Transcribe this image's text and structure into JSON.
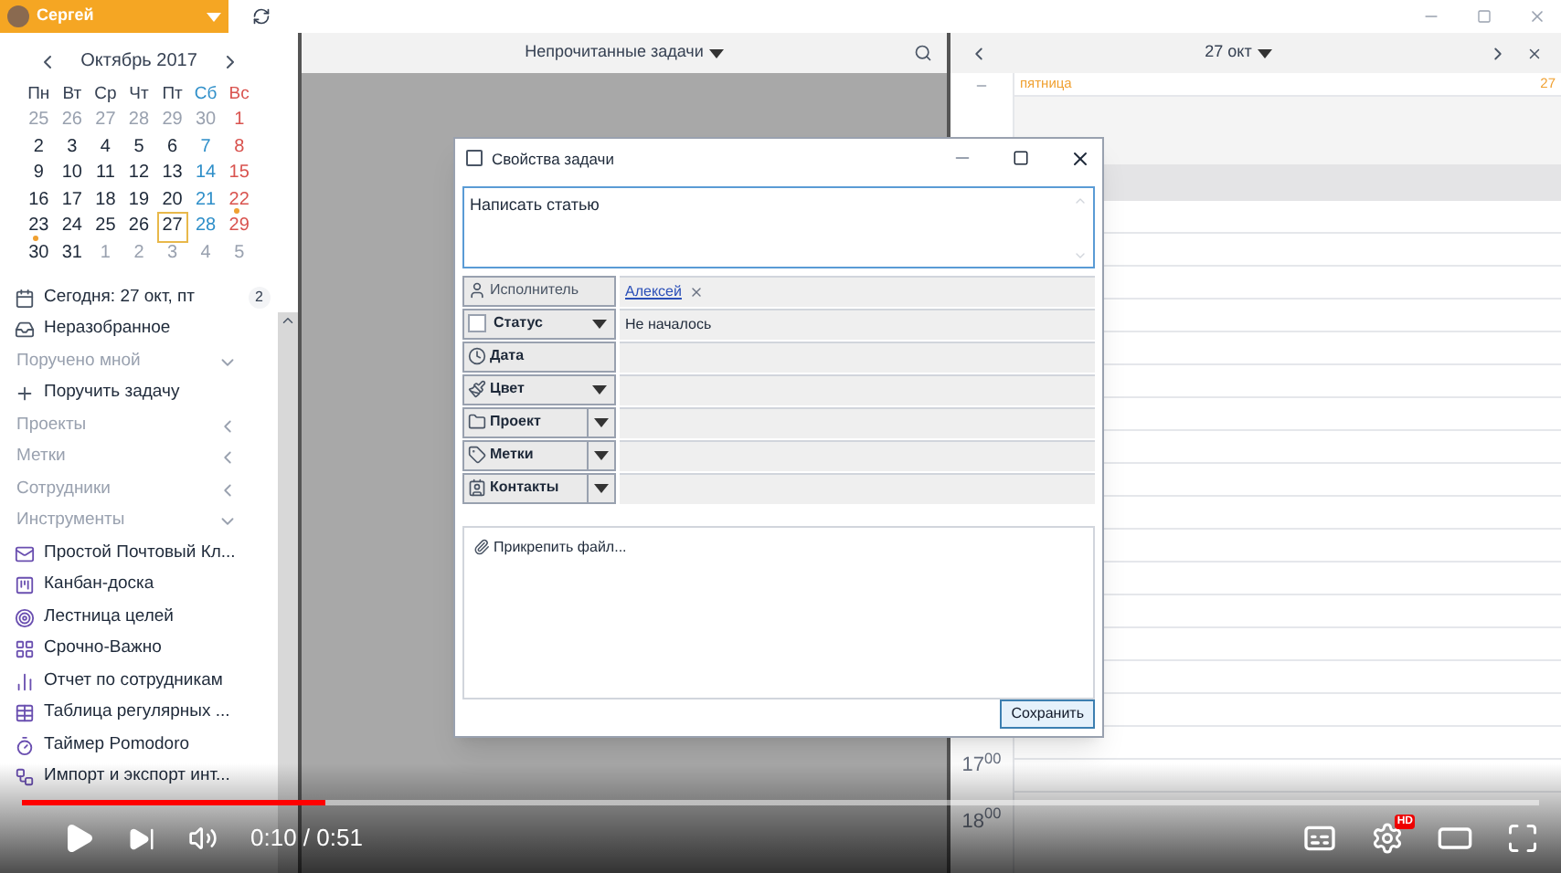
{
  "user": {
    "name": "Сергей"
  },
  "calendar": {
    "month": "Октябрь 2017",
    "weekdays": [
      "Пн",
      "Вт",
      "Ср",
      "Чт",
      "Пт",
      "Сб",
      "Вс"
    ],
    "weeks": [
      [
        {
          "d": "25",
          "muted": true,
          "today": false,
          "dot": false
        },
        {
          "d": "26",
          "muted": true,
          "today": false,
          "dot": false
        },
        {
          "d": "27",
          "muted": true,
          "today": false,
          "dot": false
        },
        {
          "d": "28",
          "muted": true,
          "today": false,
          "dot": false
        },
        {
          "d": "29",
          "muted": true,
          "today": false,
          "dot": false
        },
        {
          "d": "30",
          "muted": true,
          "today": false,
          "dot": false
        },
        {
          "d": "1",
          "muted": false,
          "today": false,
          "dot": false
        }
      ],
      [
        {
          "d": "2",
          "muted": false,
          "today": false,
          "dot": false
        },
        {
          "d": "3",
          "muted": false,
          "today": false,
          "dot": false
        },
        {
          "d": "4",
          "muted": false,
          "today": false,
          "dot": false
        },
        {
          "d": "5",
          "muted": false,
          "today": false,
          "dot": false
        },
        {
          "d": "6",
          "muted": false,
          "today": false,
          "dot": false
        },
        {
          "d": "7",
          "muted": false,
          "today": false,
          "dot": false
        },
        {
          "d": "8",
          "muted": false,
          "today": false,
          "dot": false
        }
      ],
      [
        {
          "d": "9",
          "muted": false,
          "today": false,
          "dot": false
        },
        {
          "d": "10",
          "muted": false,
          "today": false,
          "dot": false
        },
        {
          "d": "11",
          "muted": false,
          "today": false,
          "dot": false
        },
        {
          "d": "12",
          "muted": false,
          "today": false,
          "dot": false
        },
        {
          "d": "13",
          "muted": false,
          "today": false,
          "dot": false
        },
        {
          "d": "14",
          "muted": false,
          "today": false,
          "dot": false
        },
        {
          "d": "15",
          "muted": false,
          "today": false,
          "dot": false
        }
      ],
      [
        {
          "d": "16",
          "muted": false,
          "today": false,
          "dot": false
        },
        {
          "d": "17",
          "muted": false,
          "today": false,
          "dot": false
        },
        {
          "d": "18",
          "muted": false,
          "today": false,
          "dot": false
        },
        {
          "d": "19",
          "muted": false,
          "today": false,
          "dot": false
        },
        {
          "d": "20",
          "muted": false,
          "today": false,
          "dot": false
        },
        {
          "d": "21",
          "muted": false,
          "today": false,
          "dot": false
        },
        {
          "d": "22",
          "muted": false,
          "today": false,
          "dot": true
        }
      ],
      [
        {
          "d": "23",
          "muted": false,
          "today": false,
          "dot": true
        },
        {
          "d": "24",
          "muted": false,
          "today": false,
          "dot": false
        },
        {
          "d": "25",
          "muted": false,
          "today": false,
          "dot": false
        },
        {
          "d": "26",
          "muted": false,
          "today": false,
          "dot": false
        },
        {
          "d": "27",
          "muted": false,
          "today": true,
          "dot": false
        },
        {
          "d": "28",
          "muted": false,
          "today": false,
          "dot": false
        },
        {
          "d": "29",
          "muted": false,
          "today": false,
          "dot": false
        }
      ],
      [
        {
          "d": "30",
          "muted": false,
          "today": false,
          "dot": false
        },
        {
          "d": "31",
          "muted": false,
          "today": false,
          "dot": false
        },
        {
          "d": "1",
          "muted": true,
          "today": false,
          "dot": false
        },
        {
          "d": "2",
          "muted": true,
          "today": false,
          "dot": false
        },
        {
          "d": "3",
          "muted": true,
          "today": false,
          "dot": false
        },
        {
          "d": "4",
          "muted": true,
          "today": false,
          "dot": false
        },
        {
          "d": "5",
          "muted": true,
          "today": false,
          "dot": false
        }
      ]
    ]
  },
  "nav": [
    {
      "kind": "item",
      "label": "Сегодня: 27 окт, пт",
      "badge": "2"
    },
    {
      "kind": "item",
      "label": "Неразобранное"
    },
    {
      "kind": "section",
      "label": "Поручено мной",
      "expanded": true
    },
    {
      "kind": "item",
      "label": "Поручить задачу"
    },
    {
      "kind": "section",
      "label": "Проекты",
      "expanded": false
    },
    {
      "kind": "section",
      "label": "Метки",
      "expanded": false
    },
    {
      "kind": "section",
      "label": "Сотрудники",
      "expanded": false
    },
    {
      "kind": "section",
      "label": "Инструменты",
      "expanded": true
    },
    {
      "kind": "tool",
      "label": "Простой Почтовый Кл..."
    },
    {
      "kind": "tool",
      "label": "Канбан-доска"
    },
    {
      "kind": "tool",
      "label": "Лестница целей"
    },
    {
      "kind": "tool",
      "label": "Срочно-Важно"
    },
    {
      "kind": "tool",
      "label": "Отчет по сотрудникам"
    },
    {
      "kind": "tool",
      "label": "Таблица регулярных ..."
    },
    {
      "kind": "tool",
      "label": "Таймер Pomodoro"
    },
    {
      "kind": "tool",
      "label": "Импорт и экспорт инт..."
    }
  ],
  "center": {
    "title": "Непрочитанные задачи"
  },
  "right": {
    "title": "27 окт",
    "weekday": "пятница",
    "day": "27",
    "times": [
      "17$^{00}$",
      "18$^{00}$"
    ]
  },
  "dialog": {
    "title": "Свойства задачи",
    "checked": false,
    "text": "Написать статью",
    "fields": [
      {
        "kind": "button",
        "label": "Исполнитель",
        "link": "Алексей"
      },
      {
        "kind": "dropdown",
        "label": "Статус",
        "value": "Не началось",
        "checked": false
      },
      {
        "kind": "button",
        "label": "Дата"
      },
      {
        "kind": "dropdown",
        "label": "Цвет"
      },
      {
        "kind": "split",
        "label": "Проект"
      },
      {
        "kind": "split",
        "label": "Метки"
      },
      {
        "kind": "split",
        "label": "Контакты"
      }
    ],
    "attach": "Прикрепить файл...",
    "save": "Сохранить"
  },
  "player": {
    "time": "0:10 / 0:51",
    "level": 0.2,
    "hd": "HD"
  }
}
